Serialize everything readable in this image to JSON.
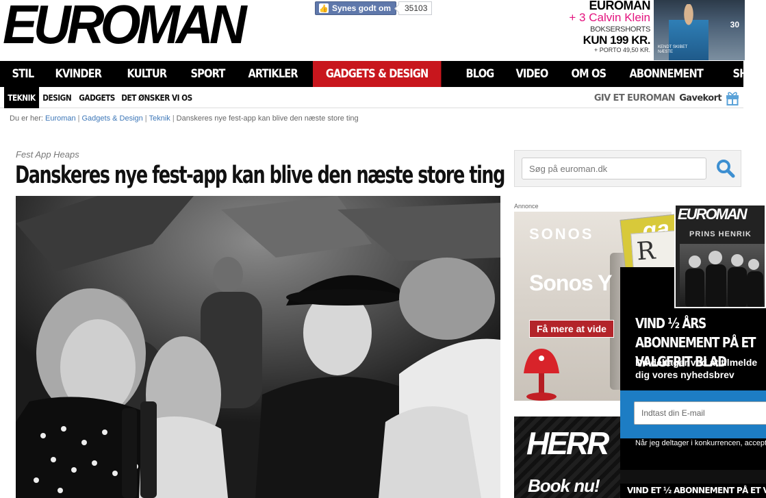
{
  "header": {
    "logo": "EUROMAN",
    "facebook_like_label": "Synes godt om",
    "facebook_like_count": "35103",
    "promo": {
      "title": "EUROMAN",
      "offer": "+ 3 Calvin Klein",
      "item": "BOKSERSHORTS",
      "price": "KUN 199 KR.",
      "shipping": "+ PORTO 49,50 KR.",
      "cover_number": "30",
      "cover_caption": "KENDT SKIBET NÆSTE"
    }
  },
  "main_nav": {
    "items": [
      {
        "label": "STIL"
      },
      {
        "label": "KVINDER"
      },
      {
        "label": "KULTUR"
      },
      {
        "label": "SPORT"
      },
      {
        "label": "ARTIKLER"
      },
      {
        "label": "GADGETS & DESIGN",
        "active": true
      },
      {
        "label": "BLOG"
      },
      {
        "label": "VIDEO"
      },
      {
        "label": "OM OS"
      },
      {
        "label": "ABONNEMENT"
      },
      {
        "label": "SHOP"
      }
    ],
    "active_color": "#c8161d"
  },
  "sub_nav": {
    "items": [
      {
        "label": "TEKNIK",
        "active": true
      },
      {
        "label": "DESIGN"
      },
      {
        "label": "GADGETS"
      },
      {
        "label": "DET ØNSKER VI OS"
      }
    ],
    "giftcard_prefix": "GIV ET EUROMAN",
    "giftcard_label": "Gavekort",
    "giftcard_icon": "gift-icon"
  },
  "breadcrumb": {
    "prefix": "Du er her:",
    "links": [
      "Euroman",
      "Gadgets & Design",
      "Teknik"
    ],
    "current": "Danskeres nye fest-app kan blive den næste store ting"
  },
  "article": {
    "kicker": "Fest App Heaps",
    "headline": "Danskeres nye fest-app kan blive den næste store ting"
  },
  "sidebar": {
    "search_placeholder": "Søg på euroman.dk",
    "search_icon": "magnifier-icon",
    "ad_label": "Annonce",
    "sonos_ad": {
      "brand": "SONOS",
      "tagline": "Sonos Y",
      "cta": "Få mere at vide"
    },
    "herr_ad": {
      "title": "HERR",
      "cta": "Book nu!"
    }
  },
  "newsletter_popup": {
    "magazine_title": "EUROMAN",
    "magazine_subtitle": "PRINS HENRIK",
    "magazine_back_letters": [
      "R",
      "ga"
    ],
    "title": "VIND ½ ÅRS ABONNEMENT PÅ ET VALGFRIT BLAD",
    "description": "Du deltager ved at tilmelde dig vores nyhedsbrev",
    "email_placeholder": "Indtast din E-mail",
    "terms": "Når jeg deltager i konkurrencen, accepterer jeg samtidigt at modtage Euromans nyhedsbrev",
    "bottom_bar": "VIND ET ½ ABONNEMENT PÅ ET VALGFRIT BLAD"
  }
}
